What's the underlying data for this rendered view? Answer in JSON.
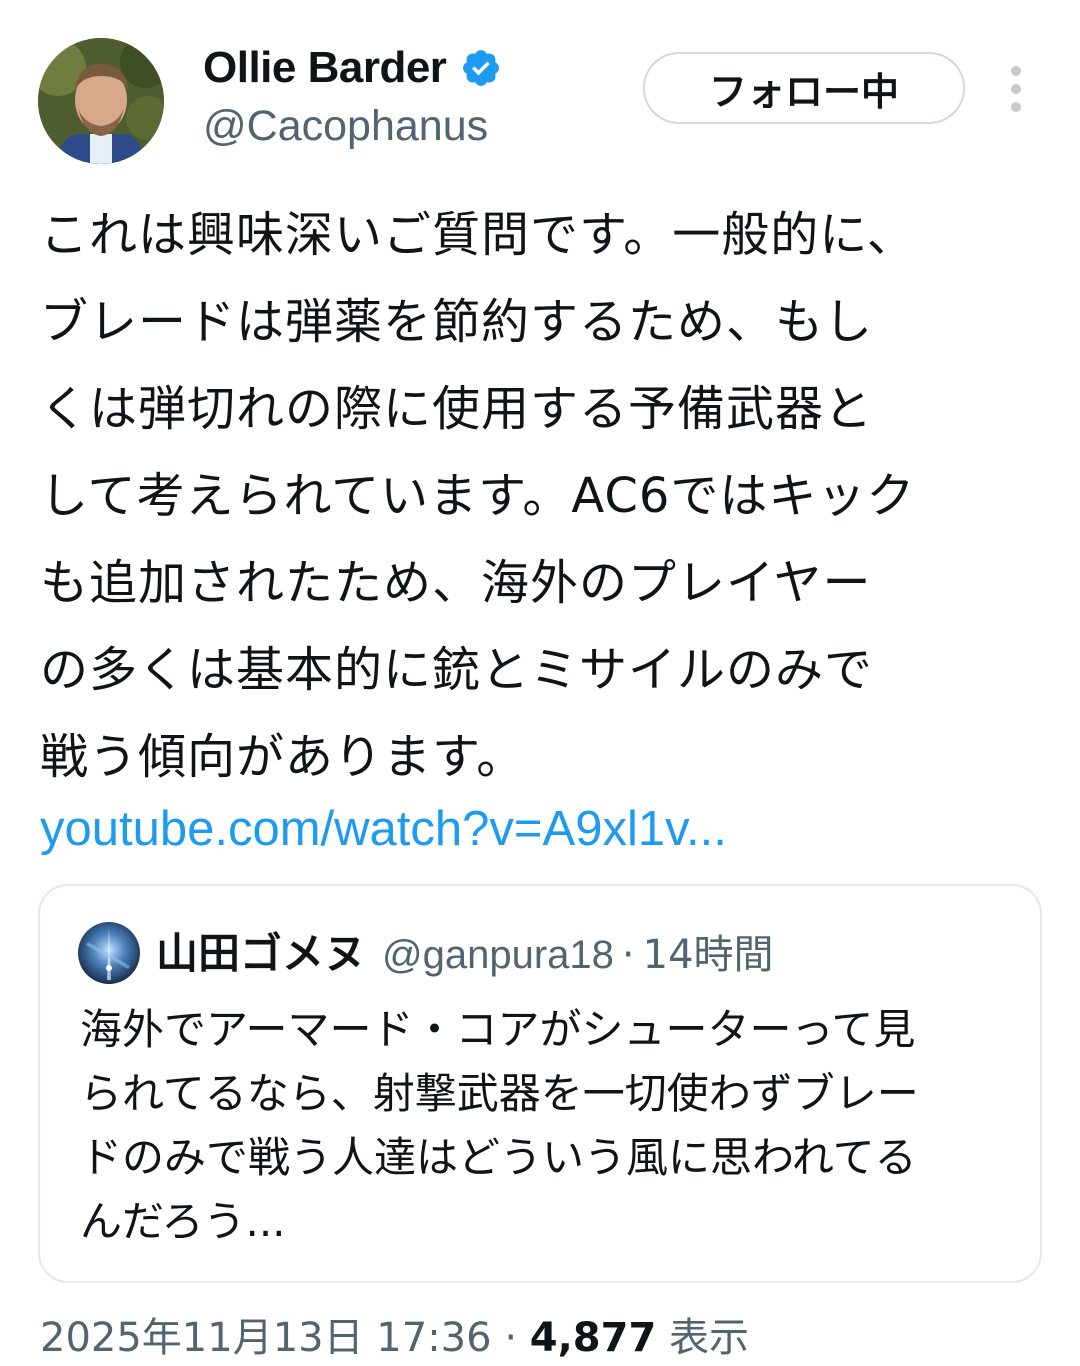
{
  "author": {
    "display_name": "Ollie Barder",
    "handle": "@Cacophanus",
    "verified": true,
    "avatar_icon": "profile-photo"
  },
  "header": {
    "follow_button_label": "フォロー中",
    "more_icon": "vertical-ellipsis-icon"
  },
  "tweet": {
    "text": "これは興味深いご質問です。一般的に、\nブレードは弾薬を節約するため、もし\nくは弾切れの際に使用する予備武器と\nして考えられています。AC6ではキック\nも追加されたため、海外のプレイヤー\nの多くは基本的に銃とミサイルのみで\n戦う傾向があります。",
    "link": "youtube.com/watch?v=A9xl1v..."
  },
  "quoted_tweet": {
    "display_name": "山田ゴメヌ",
    "handle": "@ganpura18",
    "separator": "·",
    "time": "14時間",
    "text": "海外でアーマード・コアがシューターって見\nられてるなら、射撃武器を一切使わずブレー\nドのみで戦う人達はどういう風に思われてる\nんだろう..."
  },
  "footer": {
    "timestamp": "2025年11月13日 17:36",
    "separator": "·",
    "views_count": "4,877",
    "views_label": "表示"
  },
  "colors": {
    "link": "#1d9bf0",
    "secondary_text": "#536471",
    "primary_text": "#0f1419",
    "verified_badge": "#1d9bf0",
    "border": "#cfd9de"
  }
}
